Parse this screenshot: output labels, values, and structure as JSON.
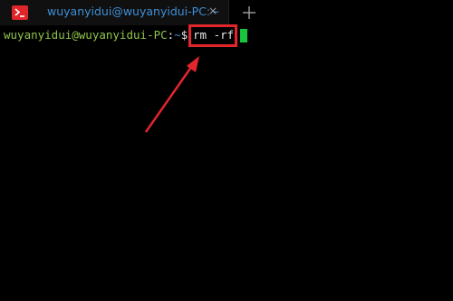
{
  "tab": {
    "title": "wuyanyidui@wuyanyidui-PC:~",
    "icon": "terminal-icon",
    "close_icon": "close-icon",
    "close_glyph": "×"
  },
  "new_tab": {
    "icon": "plus-icon"
  },
  "terminal": {
    "prompt_user": "wuyanyidui@wuyanyidui-PC",
    "prompt_separator": ":",
    "prompt_path": "~",
    "prompt_dollar": "$ ",
    "command": "rm -rf"
  },
  "colors": {
    "background": "#000000",
    "tab_text": "#3f8fd6",
    "prompt_user": "#8ec44a",
    "cursor": "#19c53e",
    "annotation": "#e3262c"
  }
}
